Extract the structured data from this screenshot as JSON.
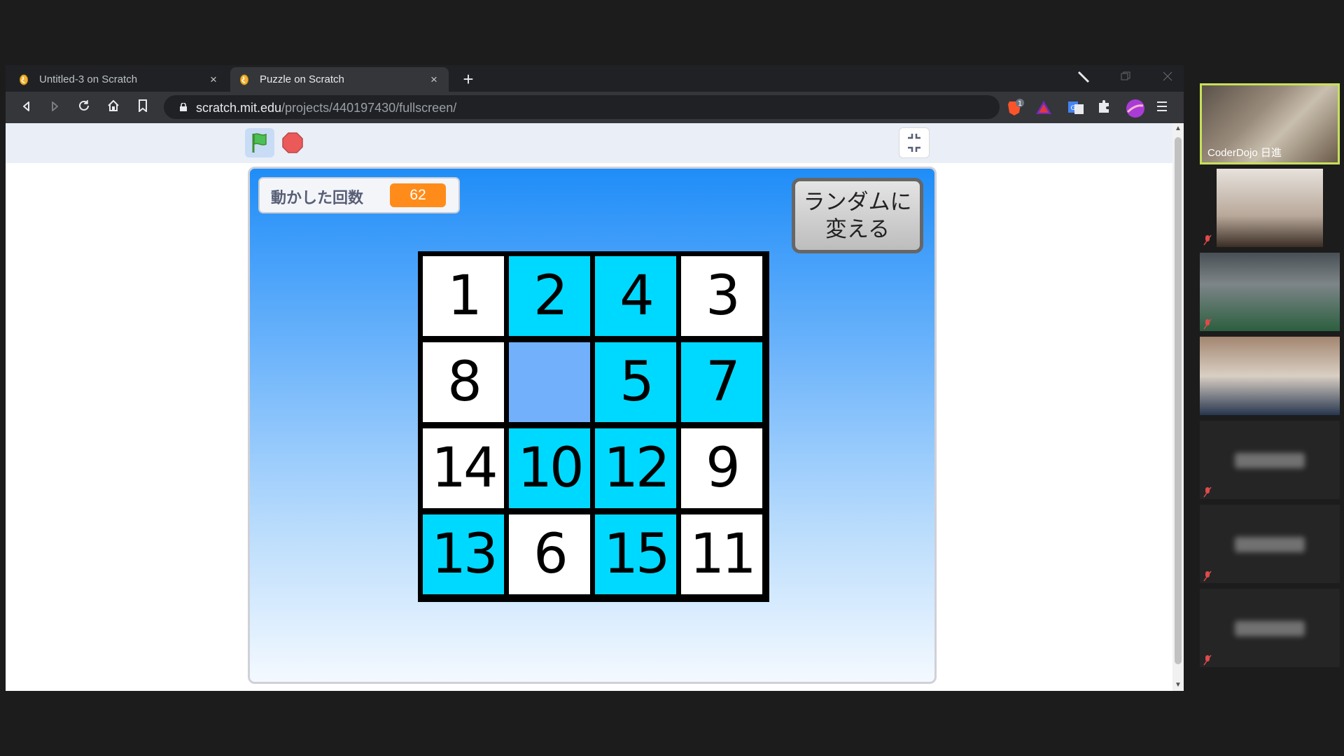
{
  "browser": {
    "tabs": [
      {
        "title": "Untitled-3 on Scratch",
        "active": false
      },
      {
        "title": "Puzzle on Scratch",
        "active": true
      }
    ],
    "new_tab_icon": "+",
    "close_icon": "×",
    "url_host": "scratch.mit.edu",
    "url_path": "/projects/440197430/fullscreen/",
    "brave_badge": "1"
  },
  "stage": {
    "counter_label": "動かした回数",
    "counter_value": "62",
    "random_button_label": "ランダムに\n変える",
    "board": [
      [
        {
          "n": "1",
          "color": "white"
        },
        {
          "n": "2",
          "color": "cyan"
        },
        {
          "n": "4",
          "color": "cyan"
        },
        {
          "n": "3",
          "color": "white"
        }
      ],
      [
        {
          "n": "8",
          "color": "white"
        },
        {
          "n": "",
          "color": "empty"
        },
        {
          "n": "5",
          "color": "cyan"
        },
        {
          "n": "7",
          "color": "cyan"
        }
      ],
      [
        {
          "n": "14",
          "color": "white"
        },
        {
          "n": "10",
          "color": "cyan"
        },
        {
          "n": "12",
          "color": "cyan"
        },
        {
          "n": "9",
          "color": "white"
        }
      ],
      [
        {
          "n": "13",
          "color": "cyan"
        },
        {
          "n": "6",
          "color": "white"
        },
        {
          "n": "15",
          "color": "cyan"
        },
        {
          "n": "11",
          "color": "white"
        }
      ]
    ]
  },
  "video_call": {
    "main_participant": "CoderDojo 日進",
    "participants": [
      {
        "name": "CoderDojo 日進",
        "has_video": true,
        "active": true
      },
      {
        "name": "",
        "has_video": true,
        "muted": true
      },
      {
        "name": "",
        "has_video": true,
        "muted": true
      },
      {
        "name": "",
        "has_video": true,
        "muted": false
      },
      {
        "name": "",
        "has_video": false,
        "muted": true
      },
      {
        "name": "",
        "has_video": false,
        "muted": true
      },
      {
        "name": "",
        "has_video": false,
        "muted": true
      }
    ]
  },
  "colors": {
    "tile_cyan": "#00d9ff",
    "tile_white": "#ffffff",
    "tile_empty": "#72b0fb",
    "counter_orange": "#ff8c1a",
    "active_speaker_border": "#c7e05a"
  }
}
